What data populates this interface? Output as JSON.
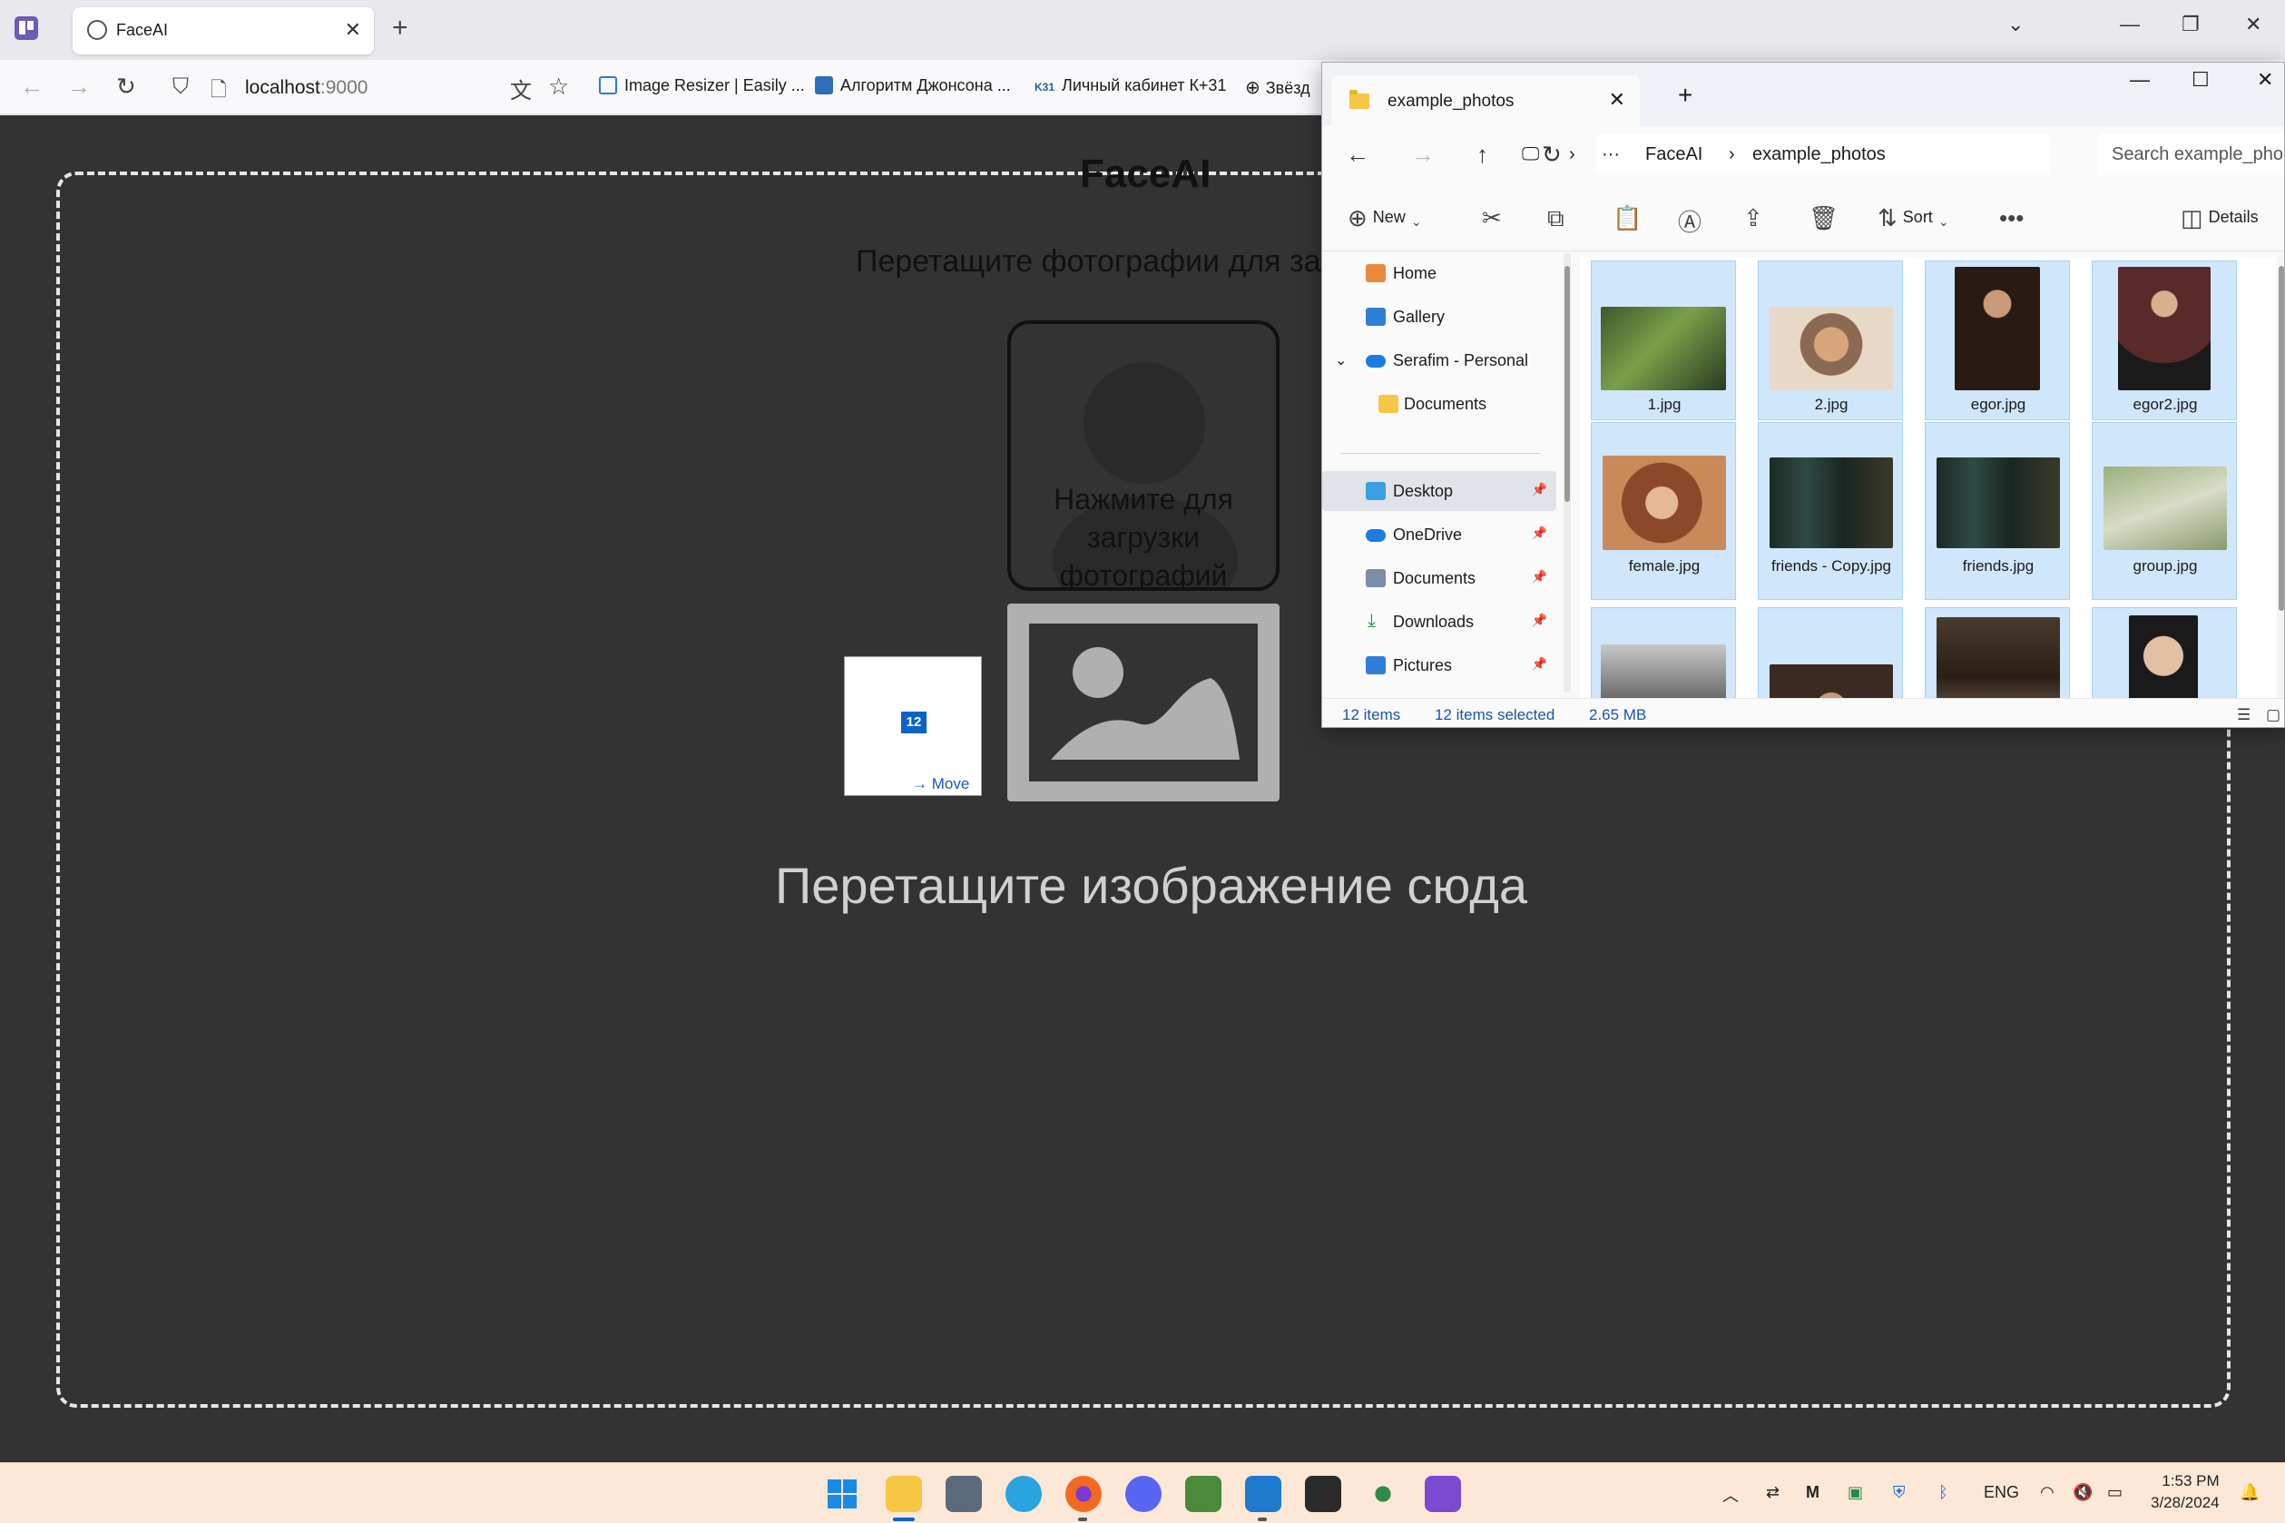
{
  "browser": {
    "tab_title": "FaceAI",
    "url_host": "localhost",
    "url_port": ":9000",
    "bookmarks": [
      "Image Resizer | Easily ...",
      "Алгоритм Джонсона ...",
      "Личный кабинет К+31",
      "Звёзд"
    ],
    "bookmark_k31_icon": "K31"
  },
  "page": {
    "title": "FaceAI",
    "subtitle": "Перетащите фотографии для за",
    "upload_text": "Нажмите для загрузки фотографий",
    "drop_text": "Перетащите изображение сюда",
    "drag_badge": "12",
    "drag_action": "Move"
  },
  "explorer": {
    "tab_title": "example_photos",
    "breadcrumb": [
      "FaceAI",
      "example_photos"
    ],
    "search_placeholder": "Search example_pho",
    "toolbar": {
      "new_label": "New",
      "sort_label": "Sort",
      "details_label": "Details"
    },
    "sidebar": [
      {
        "label": "Home",
        "icon": "home-icon"
      },
      {
        "label": "Gallery",
        "icon": "gallery-icon"
      },
      {
        "label": "Serafim - Personal",
        "icon": "onedrive-icon"
      },
      {
        "label": "Documents",
        "icon": "folder-icon"
      },
      {
        "label": "Desktop",
        "icon": "desktop-icon"
      },
      {
        "label": "OneDrive",
        "icon": "onedrive-icon"
      },
      {
        "label": "Documents",
        "icon": "documents-icon"
      },
      {
        "label": "Downloads",
        "icon": "download-icon"
      },
      {
        "label": "Pictures",
        "icon": "pictures-icon"
      }
    ],
    "files": [
      "1.jpg",
      "2.jpg",
      "egor.jpg",
      "egor2.jpg",
      "female.jpg",
      "friends - Copy.jpg",
      "friends.jpg",
      "group.jpg",
      "",
      "",
      "",
      ""
    ],
    "status": {
      "count": "12 items",
      "selected": "12 items selected",
      "size": "2.65 MB"
    }
  },
  "taskbar": {
    "language": "ENG",
    "time": "1:53 PM",
    "date": "3/28/2024"
  },
  "colors": {
    "page_bg": "#333333",
    "selection": "#cfe6fb",
    "accent": "#0a63c9"
  }
}
